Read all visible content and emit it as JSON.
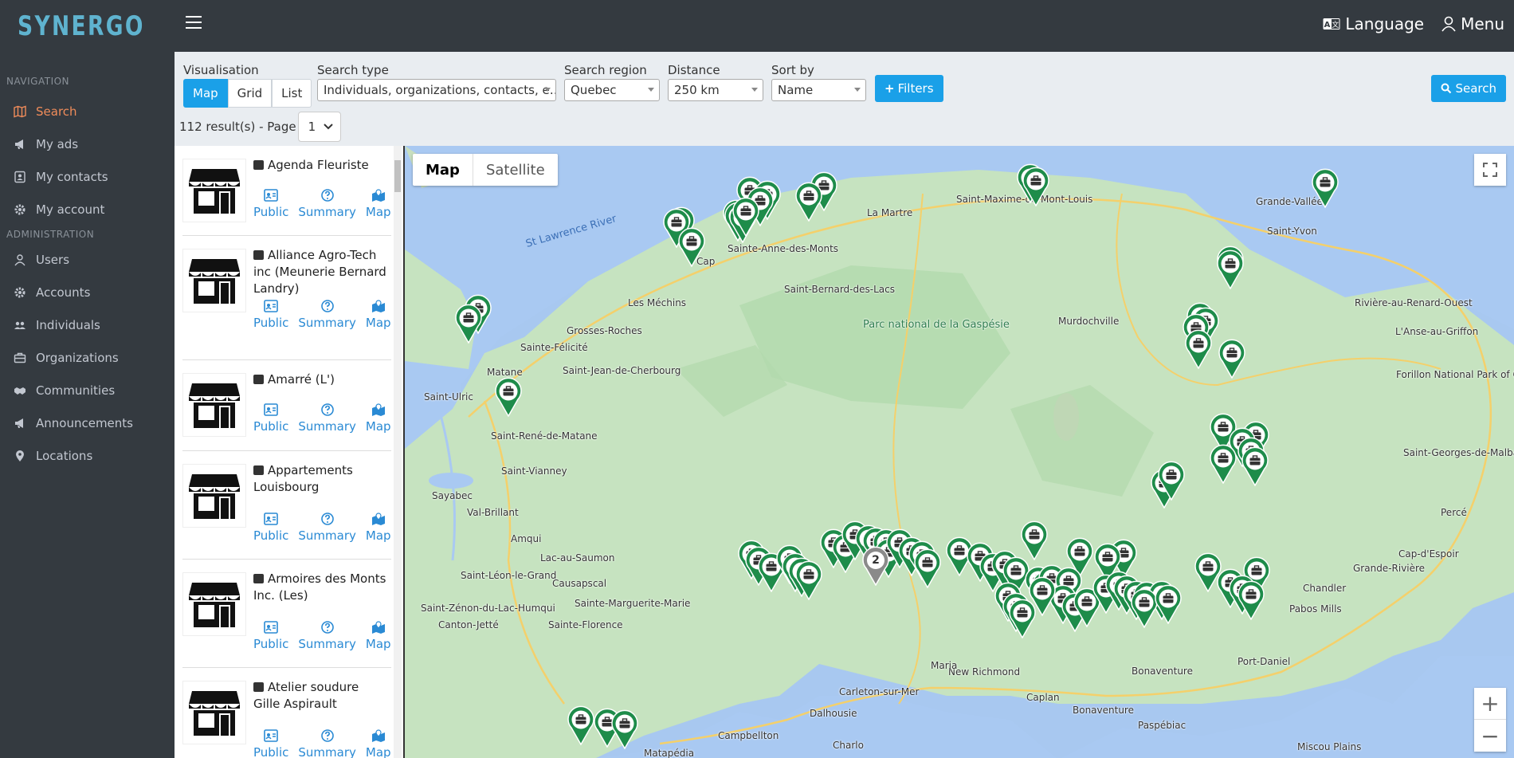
{
  "brand": {
    "name": "SYNERGO"
  },
  "sidebar": {
    "nav_header": "NAVIGATION",
    "nav_items": [
      {
        "label": "Search",
        "icon": "map-icon"
      },
      {
        "label": "My ads",
        "icon": "megaphone-icon"
      },
      {
        "label": "My contacts",
        "icon": "address-card-icon"
      },
      {
        "label": "My account",
        "icon": "gear-icon"
      }
    ],
    "admin_header": "ADMINISTRATION",
    "admin_items": [
      {
        "label": "Users",
        "icon": "user-icon"
      },
      {
        "label": "Accounts",
        "icon": "gear-icon"
      },
      {
        "label": "Individuals",
        "icon": "users-icon"
      },
      {
        "label": "Organizations",
        "icon": "briefcase-icon"
      },
      {
        "label": "Communities",
        "icon": "handshake-icon"
      },
      {
        "label": "Announcements",
        "icon": "megaphone-icon"
      },
      {
        "label": "Locations",
        "icon": "map-marker-icon"
      }
    ]
  },
  "topbar": {
    "language": "Language",
    "menu": "Menu"
  },
  "toolbar": {
    "visualisation_label": "Visualisation",
    "visualisation_options": [
      "Map",
      "Grid",
      "List"
    ],
    "search_type_label": "Search type",
    "search_type_value": "Individuals, organizations, contacts, e…",
    "search_region_label": "Search region",
    "search_region_value": "Quebec",
    "distance_label": "Distance",
    "distance_value": "250 km",
    "sort_label": "Sort by",
    "sort_value": "Name",
    "filters_label": "Filters",
    "search_label": "Search",
    "results_text": "112 result(s) - Page",
    "page_value": "1"
  },
  "list": {
    "action_labels": {
      "public": "Public",
      "summary": "Summary",
      "map": "Map"
    },
    "items": [
      {
        "title": "Agenda Fleuriste"
      },
      {
        "title": "Alliance Agro-Tech inc (Meunerie Bernard Landry)"
      },
      {
        "title": "Amarré (L')"
      },
      {
        "title": "Appartements Louisbourg"
      },
      {
        "title": "Armoires des Monts Inc. (Les)"
      },
      {
        "title": "Atelier soudure Gille Aspirault"
      }
    ]
  },
  "map": {
    "type_map": "Map",
    "type_satellite": "Satellite",
    "cluster_count": "2",
    "places": [
      "Saint-Maxime-du-Mont-Louis",
      "Grande-Vallée",
      "Saint-Yvon",
      "Sainte-Anne-des-Monts",
      "La Martre",
      "Saint-Bernard-des-Lacs",
      "Les Méchins",
      "Grosses-Roches",
      "Sainte-Félicité",
      "Saint-Jean-de-Cherbourg",
      "Matane",
      "Saint-Ulric",
      "Saint-René-de-Matane",
      "Saint-Vianney",
      "Sayabec",
      "Val-Brillant",
      "Amqui",
      "Lac-au-Saumon",
      "Saint-Léon-le-Grand",
      "Causapscal",
      "Saint-Zénon-du-Lac-Humqui",
      "Sainte-Marguerite-Marie",
      "Canton-Jetté",
      "Sainte-Florence",
      "Murdochville",
      "Rivière-au-Renard-Ouest",
      "L'Anse-au-Griffon",
      "Forillon National Park of Canada",
      "Saint-Georges-de-Malbaie",
      "Percé",
      "Cap-d'Espoir",
      "Grande-Rivière",
      "Chandler",
      "Pabos Mills",
      "Port-Daniel",
      "New Richmond",
      "Caplan",
      "Bonaventure",
      "Paspébiac",
      "Maria",
      "Carleton-sur-Mer",
      "Dalhousie",
      "Campbellton",
      "Charlo",
      "Matapédia",
      "Miscou Plains",
      "Cap",
      "Bonaventure"
    ],
    "water_label": "St Lawrence River",
    "park_label": "Parc national de la Gaspésie"
  },
  "colors": {
    "accent": "#1aa0e8",
    "active_nav": "#f08c5a",
    "pin": "#1e8c4a",
    "sidebar": "#343a40"
  }
}
